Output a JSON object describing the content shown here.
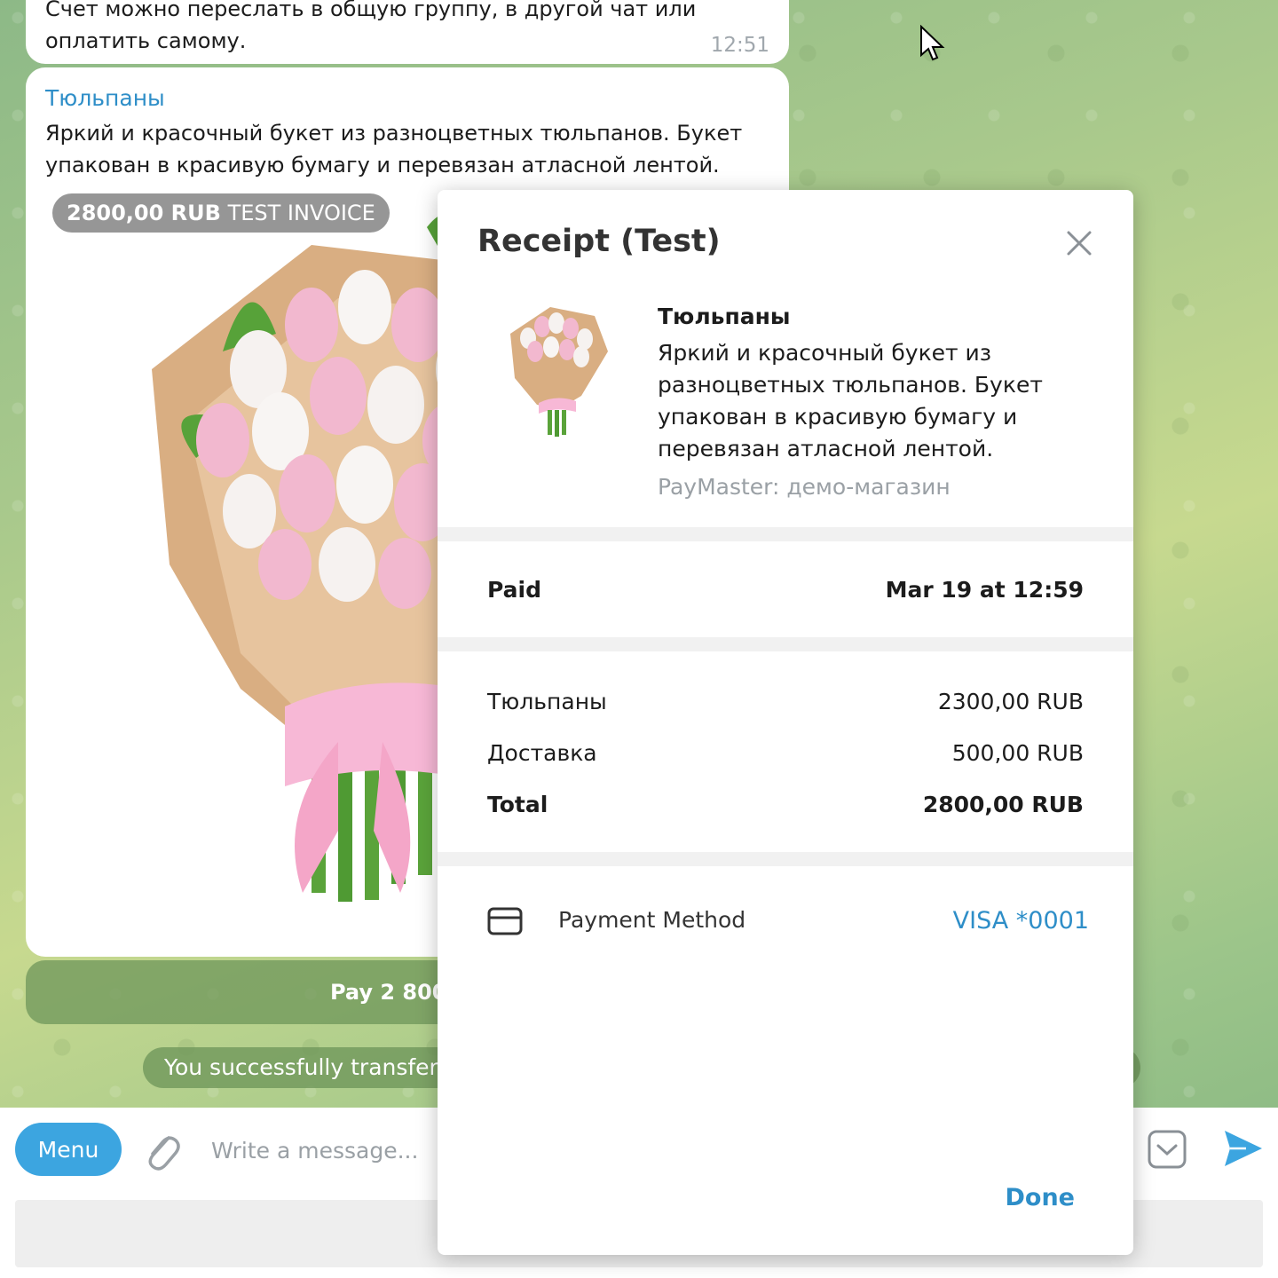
{
  "chat": {
    "prev_message": {
      "text": "Счет можно переслать в общую группу, в другой чат или оплатить самому.",
      "time": "12:51"
    },
    "invoice": {
      "title": "Тюльпаны",
      "description": "Яркий и красочный букет из разноцветных тюльпанов. Букет упакован в красивую бумагу и перевязан атласной лентой.",
      "price_amount": "2800,00 RUB",
      "price_label": "TEST INVOICE",
      "pay_button": "Pay 2 800,00"
    },
    "service_message": "You successfully transfer",
    "colors": {
      "accent": "#3ca5e0",
      "link": "#2e8ec8",
      "tulip_pink": "#f2b8cf",
      "wrap_paper": "#d9ae82",
      "ribbon": "#f7b8d6",
      "stem_green": "#5aa33a"
    }
  },
  "composer": {
    "menu_label": "Menu",
    "placeholder": "Write a message..."
  },
  "receipt": {
    "title": "Receipt (Test)",
    "product": {
      "name": "Тюльпаны",
      "description": "Яркий и красочный букет из разноцветных тюльпанов. Букет упакован в красивую бумагу и перевязан атласной лентой.",
      "seller": "PayMaster: демо-магазин"
    },
    "paid": {
      "label": "Paid",
      "value": "Mar 19 at 12:59"
    },
    "items": [
      {
        "label": "Тюльпаны",
        "value": "2300,00 RUB"
      },
      {
        "label": "Доставка",
        "value": "500,00 RUB"
      }
    ],
    "total": {
      "label": "Total",
      "value": "2800,00 RUB"
    },
    "payment_method": {
      "label": "Payment Method",
      "value": "VISA *0001"
    },
    "done_label": "Done"
  },
  "icons": [
    "attach-icon",
    "emoji-icon",
    "send-icon",
    "close-icon",
    "card-icon",
    "cursor-icon"
  ]
}
